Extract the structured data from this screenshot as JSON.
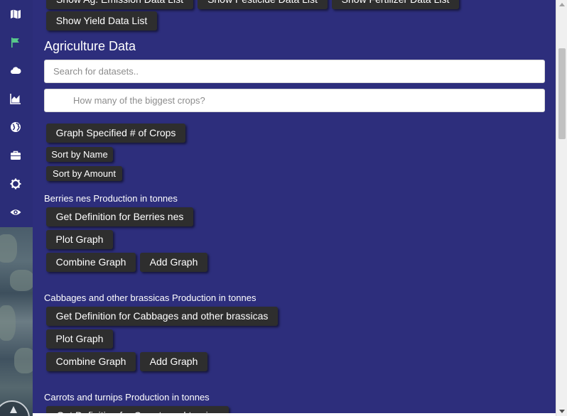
{
  "rail": {
    "icons": [
      "map-icon",
      "flag-icon",
      "cloud-icon",
      "area-chart-icon",
      "globe-icon",
      "briefcase-icon",
      "gear-icon",
      "eye-icon"
    ]
  },
  "colors": {
    "panel_bg": "#2d2e7c",
    "rail_bg": "#2b2d78",
    "button_bg": "#2e2e2e",
    "flag_active": "#58c98a"
  },
  "top_buttons": {
    "emission": "Show Ag. Emission Data List",
    "pesticide": "Show Pesticide Data List",
    "fertilizer": "Show Fertilizer Data List",
    "yield": "Show Yield Data List"
  },
  "section_title": "Agriculture Data",
  "search": {
    "placeholder": "Search for datasets..",
    "value": ""
  },
  "crop_count": {
    "placeholder": "How many of the biggest crops?",
    "value": ""
  },
  "controls": {
    "graph_specified": "Graph Specified # of Crops",
    "sort_name": "Sort by Name",
    "sort_amount": "Sort by Amount"
  },
  "datasets": [
    {
      "label": "Berries nes Production in tonnes",
      "definition_button": "Get Definition for Berries nes",
      "plot_button": "Plot Graph",
      "combine_button": "Combine Graph",
      "add_button": "Add Graph"
    },
    {
      "label": "Cabbages and other brassicas Production in tonnes",
      "definition_button": "Get Definition for Cabbages and other brassicas",
      "plot_button": "Plot Graph",
      "combine_button": "Combine Graph",
      "add_button": "Add Graph"
    },
    {
      "label": "Carrots and turnips Production in tonnes",
      "definition_button": "Get Definition for Carrots and turnips"
    }
  ]
}
